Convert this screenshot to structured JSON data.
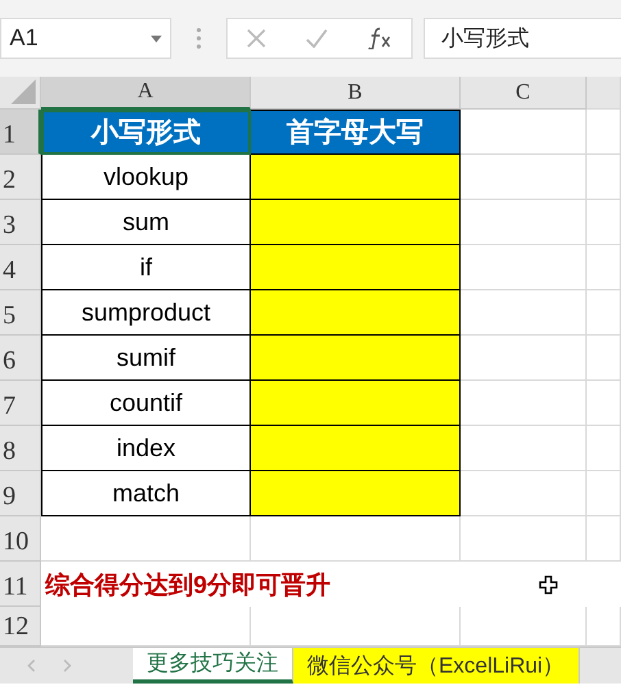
{
  "name_box": "A1",
  "formula_bar": {
    "value": "小写形式"
  },
  "column_headers": [
    "A",
    "B",
    "C"
  ],
  "row_headers": [
    "1",
    "2",
    "3",
    "4",
    "5",
    "6",
    "7",
    "8",
    "9",
    "10",
    "11",
    "12"
  ],
  "table": {
    "header": [
      "小写形式",
      "首字母大写"
    ],
    "rows": [
      {
        "name": "vlookup"
      },
      {
        "name": "sum"
      },
      {
        "name": "if"
      },
      {
        "name": "sumproduct"
      },
      {
        "name": "sumif"
      },
      {
        "name": "countif"
      },
      {
        "name": "index"
      },
      {
        "name": "match"
      }
    ]
  },
  "note": "综合得分达到9分即可晋升",
  "sheet_tabs": [
    {
      "label": "更多技巧关注",
      "selected": true,
      "color": "#ffffff"
    },
    {
      "label": "微信公众号（ExcelLiRui）",
      "selected": false,
      "color": "#ffff00"
    }
  ]
}
